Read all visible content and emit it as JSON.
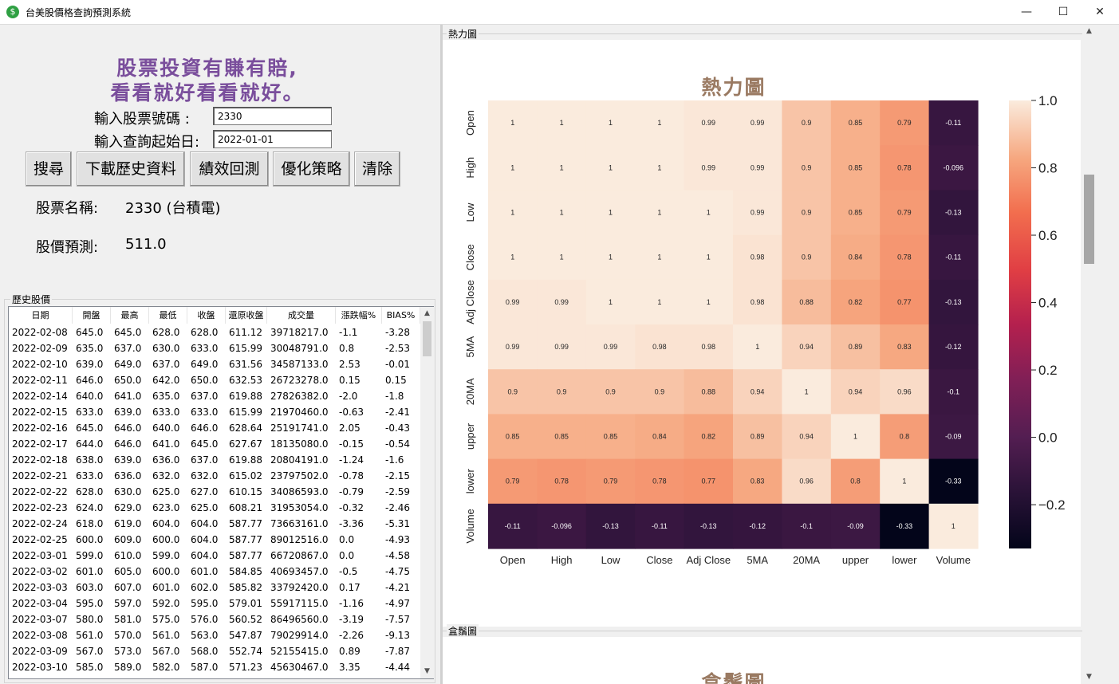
{
  "window": {
    "title": "台美股價格查詢預測系統",
    "icon": "dollar-icon",
    "minimize": "—",
    "maximize": "☐",
    "close": "✕"
  },
  "left": {
    "slogan_line1": "股票投資有賺有賠,",
    "slogan_line2": "看看就好看看就好。",
    "stock_code_label": "輸入股票號碼 :",
    "stock_code_value": "2330",
    "start_date_label": "輸入查詢起始日:",
    "start_date_value": "2022-01-01",
    "buttons": {
      "search": "搜尋",
      "download": "下載歷史資料",
      "backtest": "績效回測",
      "optimize": "優化策略",
      "clear": "清除"
    },
    "stock_name_label": "股票名稱:",
    "stock_name_value": "2330 (台積電)",
    "prediction_label": "股價預測:",
    "prediction_value": "511.0",
    "history_group": "歷史股價"
  },
  "table": {
    "columns": [
      "日期",
      "開盤",
      "最高",
      "最低",
      "收盤",
      "還原收盤",
      "成交量",
      "漲跌幅%",
      "BIAS%"
    ],
    "rows": [
      [
        "2022-02-08",
        "645.0",
        "645.0",
        "628.0",
        "628.0",
        "611.12",
        "39718217.0",
        "-1.1",
        "-3.28"
      ],
      [
        "2022-02-09",
        "635.0",
        "637.0",
        "630.0",
        "633.0",
        "615.99",
        "30048791.0",
        "0.8",
        "-2.53"
      ],
      [
        "2022-02-10",
        "639.0",
        "649.0",
        "637.0",
        "649.0",
        "631.56",
        "34587133.0",
        "2.53",
        "-0.01"
      ],
      [
        "2022-02-11",
        "646.0",
        "650.0",
        "642.0",
        "650.0",
        "632.53",
        "26723278.0",
        "0.15",
        "0.15"
      ],
      [
        "2022-02-14",
        "640.0",
        "641.0",
        "635.0",
        "637.0",
        "619.88",
        "27826382.0",
        "-2.0",
        "-1.8"
      ],
      [
        "2022-02-15",
        "633.0",
        "639.0",
        "633.0",
        "633.0",
        "615.99",
        "21970460.0",
        "-0.63",
        "-2.41"
      ],
      [
        "2022-02-16",
        "645.0",
        "646.0",
        "640.0",
        "646.0",
        "628.64",
        "25191741.0",
        "2.05",
        "-0.43"
      ],
      [
        "2022-02-17",
        "644.0",
        "646.0",
        "641.0",
        "645.0",
        "627.67",
        "18135080.0",
        "-0.15",
        "-0.54"
      ],
      [
        "2022-02-18",
        "638.0",
        "639.0",
        "636.0",
        "637.0",
        "619.88",
        "20804191.0",
        "-1.24",
        "-1.6"
      ],
      [
        "2022-02-21",
        "633.0",
        "636.0",
        "632.0",
        "632.0",
        "615.02",
        "23797502.0",
        "-0.78",
        "-2.15"
      ],
      [
        "2022-02-22",
        "628.0",
        "630.0",
        "625.0",
        "627.0",
        "610.15",
        "34086593.0",
        "-0.79",
        "-2.59"
      ],
      [
        "2022-02-23",
        "624.0",
        "629.0",
        "623.0",
        "625.0",
        "608.21",
        "31953054.0",
        "-0.32",
        "-2.46"
      ],
      [
        "2022-02-24",
        "618.0",
        "619.0",
        "604.0",
        "604.0",
        "587.77",
        "73663161.0",
        "-3.36",
        "-5.31"
      ],
      [
        "2022-02-25",
        "600.0",
        "609.0",
        "600.0",
        "604.0",
        "587.77",
        "89012516.0",
        "0.0",
        "-4.93"
      ],
      [
        "2022-03-01",
        "599.0",
        "610.0",
        "599.0",
        "604.0",
        "587.77",
        "66720867.0",
        "0.0",
        "-4.58"
      ],
      [
        "2022-03-02",
        "601.0",
        "605.0",
        "600.0",
        "601.0",
        "584.85",
        "40693457.0",
        "-0.5",
        "-4.75"
      ],
      [
        "2022-03-03",
        "603.0",
        "607.0",
        "601.0",
        "602.0",
        "585.82",
        "33792420.0",
        "0.17",
        "-4.21"
      ],
      [
        "2022-03-04",
        "595.0",
        "597.0",
        "592.0",
        "595.0",
        "579.01",
        "55917115.0",
        "-1.16",
        "-4.97"
      ],
      [
        "2022-03-07",
        "580.0",
        "581.0",
        "575.0",
        "576.0",
        "560.52",
        "86496560.0",
        "-3.19",
        "-7.57"
      ],
      [
        "2022-03-08",
        "561.0",
        "570.0",
        "561.0",
        "563.0",
        "547.87",
        "79029914.0",
        "-2.26",
        "-9.13"
      ],
      [
        "2022-03-09",
        "567.0",
        "573.0",
        "567.0",
        "568.0",
        "552.74",
        "52155415.0",
        "0.89",
        "-7.87"
      ],
      [
        "2022-03-10",
        "585.0",
        "589.0",
        "582.0",
        "587.0",
        "571.23",
        "45630467.0",
        "3.35",
        "-4.44"
      ]
    ]
  },
  "right": {
    "heatmap_group": "熱力圖",
    "boxplot_group": "盒鬚圖",
    "boxplot_title": "盒鬚圖"
  },
  "chart_data": {
    "type": "heatmap",
    "title": "熱力圖",
    "labels": [
      "Open",
      "High",
      "Low",
      "Close",
      "Adj Close",
      "5MA",
      "20MA",
      "upper",
      "lower",
      "Volume"
    ],
    "matrix": [
      [
        1,
        1,
        1,
        1,
        0.99,
        0.99,
        0.9,
        0.85,
        0.79,
        -0.11
      ],
      [
        1,
        1,
        1,
        1,
        0.99,
        0.99,
        0.9,
        0.85,
        0.78,
        -0.096
      ],
      [
        1,
        1,
        1,
        1,
        1,
        0.99,
        0.9,
        0.85,
        0.79,
        -0.13
      ],
      [
        1,
        1,
        1,
        1,
        1,
        0.98,
        0.9,
        0.84,
        0.78,
        -0.11
      ],
      [
        0.99,
        0.99,
        1,
        1,
        1,
        0.98,
        0.88,
        0.82,
        0.77,
        -0.13
      ],
      [
        0.99,
        0.99,
        0.99,
        0.98,
        0.98,
        1,
        0.94,
        0.89,
        0.83,
        -0.12
      ],
      [
        0.9,
        0.9,
        0.9,
        0.9,
        0.88,
        0.94,
        1,
        0.94,
        0.96,
        -0.1
      ],
      [
        0.85,
        0.85,
        0.85,
        0.84,
        0.82,
        0.89,
        0.94,
        1,
        0.8,
        -0.09
      ],
      [
        0.79,
        0.78,
        0.79,
        0.78,
        0.77,
        0.83,
        0.96,
        0.8,
        1,
        -0.33
      ],
      [
        -0.11,
        -0.096,
        -0.13,
        -0.11,
        -0.13,
        -0.12,
        -0.1,
        -0.09,
        -0.33,
        1
      ]
    ],
    "colorbar_ticks": [
      "1.0",
      "0.8",
      "0.6",
      "0.4",
      "0.2",
      "0.0",
      "−0.2"
    ],
    "colorbar_range": [
      -0.33,
      1.0
    ]
  }
}
